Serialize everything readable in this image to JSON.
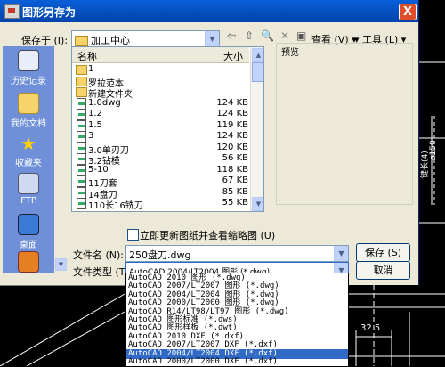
{
  "dialog": {
    "title": "图形另存为",
    "close_label": "X"
  },
  "save_in": {
    "label": "保存于 (I):",
    "value": "加工中心"
  },
  "toolbar": {
    "view_label": "查看 (V)",
    "tools_label": "工具 (L)"
  },
  "places": [
    {
      "label": "历史记录",
      "icon": "history-icon"
    },
    {
      "label": "我的文档",
      "icon": "my-documents-icon"
    },
    {
      "label": "收藏夹",
      "icon": "favorites-icon"
    },
    {
      "label": "FTP",
      "icon": "ftp-icon"
    },
    {
      "label": "桌面",
      "icon": "desktop-icon"
    },
    {
      "label": "",
      "icon": "buzzsaw-icon"
    }
  ],
  "file_list": {
    "col_name": "名称",
    "col_size": "大小",
    "rows": [
      {
        "name": "1",
        "size": "",
        "type": "folder"
      },
      {
        "name": "罗拉范本",
        "size": "",
        "type": "folder"
      },
      {
        "name": "新建文件夹",
        "size": "",
        "type": "folder"
      },
      {
        "name": "1.0dwg",
        "size": "124 KB",
        "type": "dwg"
      },
      {
        "name": "1.2",
        "size": "124 KB",
        "type": "dwg"
      },
      {
        "name": "1.5",
        "size": "119 KB",
        "type": "dwg"
      },
      {
        "name": "3",
        "size": "124 KB",
        "type": "dwg"
      },
      {
        "name": "3.0单刃刀",
        "size": "120 KB",
        "type": "dwg"
      },
      {
        "name": "3.2钻模",
        "size": "56 KB",
        "type": "dwg"
      },
      {
        "name": "5-10",
        "size": "118 KB",
        "type": "dwg"
      },
      {
        "name": "11刀套",
        "size": "67 KB",
        "type": "dwg"
      },
      {
        "name": "14盘刀",
        "size": "85 KB",
        "type": "dwg"
      },
      {
        "name": "110长16铣刀",
        "size": "55 KB",
        "type": "dwg"
      }
    ]
  },
  "preview": {
    "label": "预览"
  },
  "update_thumbnail": {
    "label": "立即更新图纸并查看缩略图 (U)",
    "checked": false
  },
  "file_name": {
    "label": "文件名 (N):",
    "value": "250盘刀.dwg"
  },
  "file_type": {
    "label": "文件类型 (T):",
    "value": "AutoCAD 2004/LT2004 图形 (*.dwg)",
    "options": [
      "AutoCAD 2010 图形 (*.dwg)",
      "AutoCAD 2007/LT2007 图形 (*.dwg)",
      "AutoCAD 2004/LT2004 图形 (*.dwg)",
      "AutoCAD 2000/LT2000 图形 (*.dwg)",
      "AutoCAD R14/LT98/LT97 图形 (*.dwg)",
      "AutoCAD 图形标准 (*.dws)",
      "AutoCAD 图形样板 (*.dwt)",
      "AutoCAD 2010 DXF (*.dxf)",
      "AutoCAD 2007/LT2007 DXF (*.dxf)",
      "AutoCAD 2004/LT2004 DXF (*.dxf)",
      "AutoCAD 2000/LT2000 DXF (*.dxf)"
    ],
    "selected_index": 9
  },
  "buttons": {
    "save": "保存 (S)",
    "cancel": "取消"
  },
  "cad_dims": {
    "d150": "ø150",
    "vertical": "键长(4)",
    "bottom": "32.5"
  }
}
